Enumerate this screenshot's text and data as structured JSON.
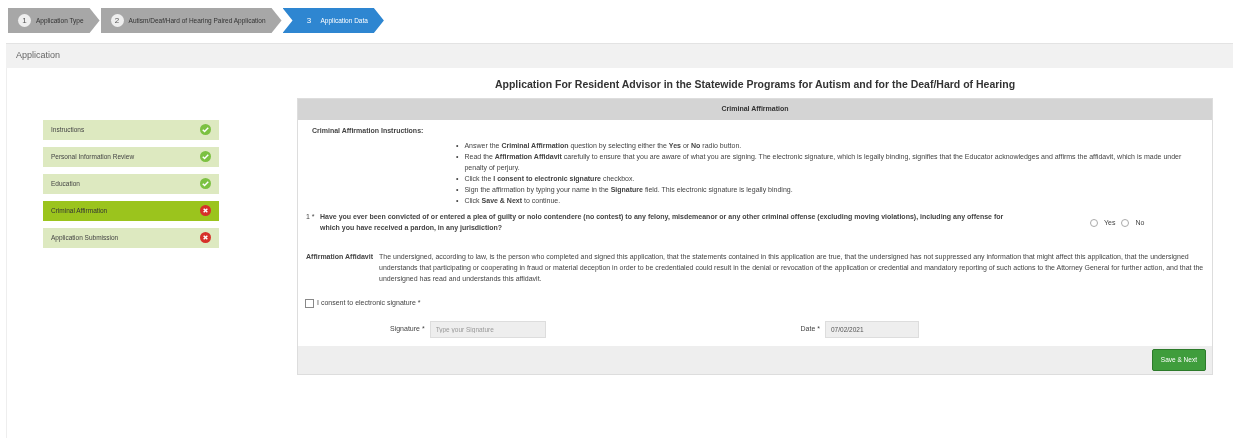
{
  "steps": [
    {
      "number": "1",
      "label": "Application Type",
      "selected": false
    },
    {
      "number": "2",
      "label": "Autism/Deaf/Hard of Hearing Paired Application",
      "selected": false
    },
    {
      "number": "3",
      "label": "Application Data",
      "selected": true
    }
  ],
  "page_header": "Application",
  "title": "Application For Resident Advisor in the Statewide Programs for Autism and for the Deaf/Hard of Hearing",
  "sidebar": {
    "items": [
      {
        "label": "Instructions",
        "complete": true,
        "selected": false
      },
      {
        "label": "Personal Information Review",
        "complete": true,
        "selected": false
      },
      {
        "label": "Education",
        "complete": true,
        "selected": false
      },
      {
        "label": "Criminal Affirmation",
        "complete": false,
        "selected": true
      },
      {
        "label": "Application Submission",
        "complete": false,
        "selected": false
      }
    ]
  },
  "section_title": "Criminal Affirmation",
  "instructions_heading": "Criminal Affirmation Instructions:",
  "instructions": [
    {
      "marker": "•",
      "text": "Answer the **Criminal Affirmation** question by selecting either the **Yes** or **No** radio button."
    },
    {
      "marker": "•",
      "text": "Read the **Affirmation Affidavit** carefully to ensure that you are aware of what you are signing. The electronic signature, which is legally binding, signifies that the Educator acknowledges and affirms the affidavit, which is made under penalty of perjury."
    },
    {
      "marker": "•",
      "text": "Click the **I consent to electronic signature** checkbox."
    },
    {
      "marker": "•",
      "text": "Sign the affirmation by typing your name in the **Signature** field.  This electronic signature is legally binding."
    },
    {
      "marker": "•",
      "text": "Click **Save & Next** to continue."
    }
  ],
  "question": {
    "number": "1",
    "required_mark": "*",
    "text": "Have you ever been convicted of or entered a plea of guilty or nolo contendere (no contest) to any felony, misdemeanor or any other criminal offense (excluding moving violations), including any offense for which you have received a pardon, in any jurisdiction?",
    "options": [
      {
        "label": "Yes",
        "selected": false
      },
      {
        "label": "No",
        "selected": false
      }
    ]
  },
  "affidavit": {
    "label": "Affirmation Affidavit",
    "text": "The undersigned, according to law, is the person who completed and signed this application, that the statements contained in this application are true, that the undersigned has not suppressed any information that might affect this application, that the undersigned understands that participating or cooperating in fraud or material deception in order to be credentialed could result in the denial or revocation of the application or credential and mandatory reporting of such actions to the Attorney General for further action, and that the undersigned has read and understands this affidavit."
  },
  "consent": {
    "label": "I consent to electronic signature",
    "required_mark": "*",
    "checked": false
  },
  "signature": {
    "label": "Signature",
    "required_mark": "*",
    "placeholder": "Type your Signature"
  },
  "date": {
    "label": "Date",
    "required_mark": "*",
    "value": "07/02/2021"
  },
  "save_button": "Save & Next"
}
